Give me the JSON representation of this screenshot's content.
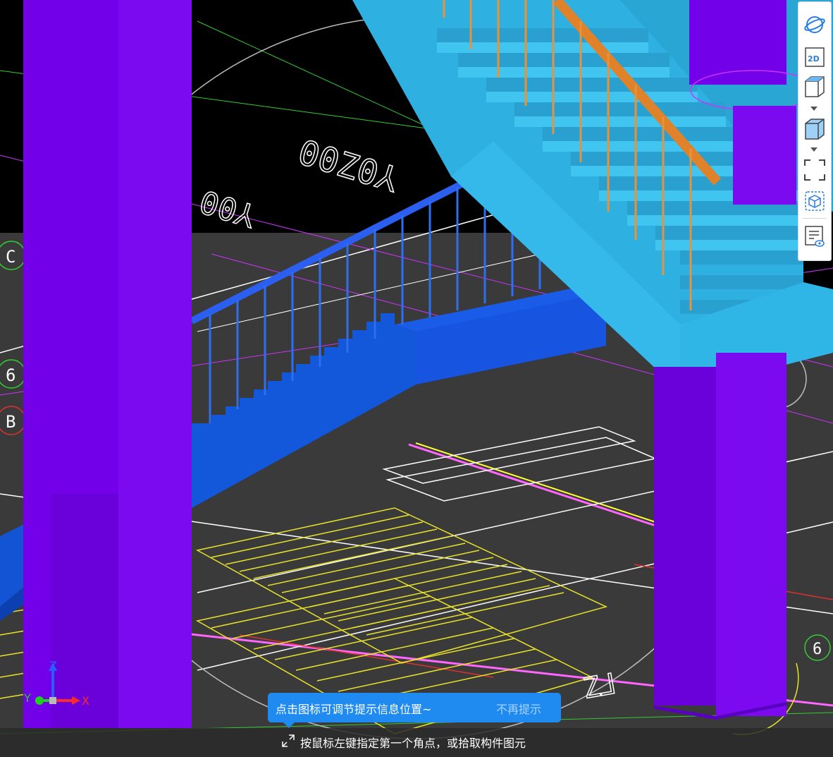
{
  "toolbar": {
    "items": [
      {
        "name": "orbit",
        "icon": "orbit-icon"
      },
      {
        "name": "2d-view",
        "icon": "2d-view-icon",
        "label": "2D"
      },
      {
        "name": "view-cube-wire",
        "icon": "cube-wire-icon"
      },
      {
        "name": "view-cube-solid",
        "icon": "cube-solid-icon"
      },
      {
        "name": "zoom-extents",
        "icon": "zoom-extents-icon"
      },
      {
        "name": "component-select",
        "icon": "component-cube-icon"
      },
      {
        "name": "properties-panel",
        "icon": "properties-list-icon"
      }
    ]
  },
  "canvas": {
    "grid_labels": [
      "C",
      "6",
      "B",
      "6"
    ],
    "axes": {
      "x": "X",
      "y": "Y",
      "z": "Z"
    },
    "colors": {
      "background": "#000000",
      "column": "#7a00ee",
      "upper_stair": "#2fb6e6",
      "lower_stair": "#1458d6",
      "handrail_upper": "#e8923a",
      "handrail_lower": "#2e6ef0",
      "floor_hatch": "#e8e22a"
    }
  },
  "tooltip": {
    "message": "点击图标可调节提示信息位置~",
    "dismiss": "不再提示"
  },
  "status": {
    "prompt": "按鼠标左键指定第一个角点，或拾取构件图元",
    "cursor_icon": "corner-select-icon"
  }
}
